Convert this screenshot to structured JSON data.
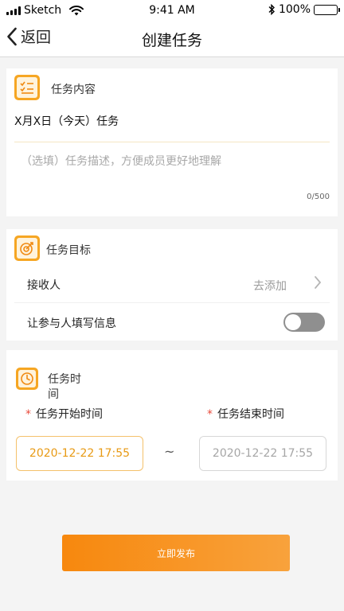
{
  "status_bar": {
    "carrier": "Sketch",
    "time": "9:41 AM",
    "battery": "100%"
  },
  "nav": {
    "back_label": "返回",
    "title": "创建任务"
  },
  "content_section": {
    "title": "任务内容",
    "task_name": "X月X日（今天）任务",
    "description_placeholder": "（选填）任务描述，方便成员更好地理解",
    "char_count": "0/500"
  },
  "goal_section": {
    "title": "任务目标",
    "receiver_label": "接收人",
    "receiver_action": "去添加",
    "fill_info_label": "让参与人填写信息",
    "fill_info_enabled": false
  },
  "time_section": {
    "title_line1": "任务时",
    "title_line2": "间",
    "required_mark": "*",
    "start_label": "任务开始时间",
    "end_label": "任务结束时间",
    "start_value": "2020-12-22 17:55",
    "end_placeholder": "2020-12-22 17:55",
    "separator": "~"
  },
  "publish_label": "立即发布",
  "colors": {
    "accent": "#f6a623",
    "button_start": "#f7880e",
    "button_end": "#f8a23c",
    "required": "#e94b3c"
  }
}
